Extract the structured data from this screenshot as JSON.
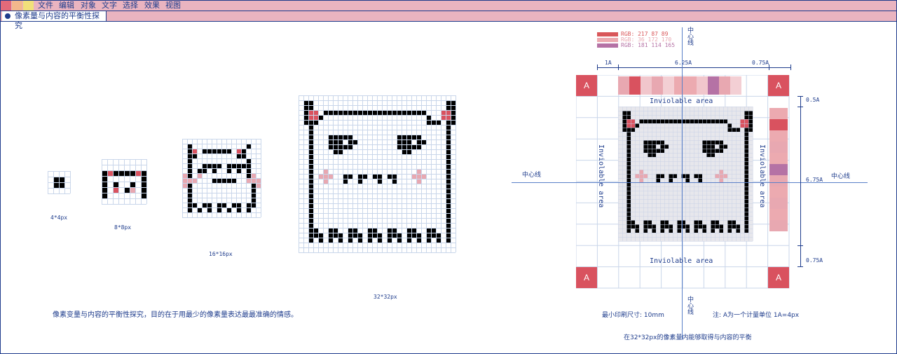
{
  "colors": {
    "menubar_bg": "#eab4c0",
    "ink": "#1e3c8c",
    "grid": "#c9d6ea",
    "black": "#000000",
    "red": "#d9525f",
    "pink": "#e8a8b1",
    "purple": "#b7729d",
    "sprite_fill": "#ffffff",
    "safe_fill": "#e7e7ec",
    "window_buttons": [
      "#e36a7a",
      "#f3b78c",
      "#f1e07a"
    ]
  },
  "menu": {
    "items": [
      "文件",
      "编辑",
      "对象",
      "文字",
      "选择",
      "效果",
      "视图"
    ]
  },
  "tab": {
    "title": "像素量与内容的平衡性探究"
  },
  "labels": {
    "s4": "4*4px",
    "s8": "8*8px",
    "s16": "16*16px",
    "s32": "32*32px"
  },
  "description": "像素变量与内容的平衡性探究，目的在于用最少的像素量表达最最准确的情感。",
  "diagram": {
    "swatches": [
      {
        "label": "RGB: 217 87 89",
        "color": "#d9575a"
      },
      {
        "label": "RGB: 36 172 170",
        "color": "#ecaab0"
      },
      {
        "label": "RGB: 181 114 165",
        "color": "#b572a5"
      }
    ],
    "top_measure": [
      "1A",
      "6.25A",
      "0.75A"
    ],
    "right_measure": [
      "0.5A",
      "6.75A",
      "0.75A"
    ],
    "center_line": "中心线",
    "inviolable": "Inviolable area",
    "corner_letter": "A",
    "min_print": "最小印刷尺寸: 10mm",
    "unit_note": "注: A为一个计量单位 1A=4px",
    "caption": "在32*32px的像素量内能够取得与内容的平衡"
  },
  "sprites": {
    "ghost32": {
      "pattern": [
        "................................",
        ".##...........................##",
        ".##...........................##",
        ".#rr.#####################...rr#",
        ".#rr#.....................#..rr#",
        ".###......................###.##",
        "..#...........................#.",
        "..#...........................#.",
        "..#...#####.........#####.....#.",
        "..#...###.##........###.##....#.",
        "..#...#####.........#####.....#.",
        "..#....##............##.......#.",
        "..#...........................#.",
        "..#...........................#.",
        "..#...........................#.",
        "..#..p..................p.....#.",
        "..#.ppp..##.##.##.##...ppp....#.",
        "..#..p...#..#...#..#....p.....#.",
        "..#...........................#.",
        "..#...........................#.",
        "..#...........................#.",
        "..#...........................#.",
        "..#...........................#.",
        "..#...........................#.",
        "..#...........................#.",
        "..#...........................#.",
        "..#...........................#.",
        "..##..##..##..##..##..##..##..#.",
        "..###.###.###.###.###.###.###.#.",
        "..#.#.#.#.#.#.#.#.#.#.#.#.#.#.#.",
        "................................",
        "................................"
      ],
      "pixel": 7,
      "grid": true
    },
    "cat16": {
      "pattern": [
        "................",
        ".#...........#..",
        ".#r.######.r#...",
        ".##........##...",
        ".#...........#..",
        ".#..####.#####..",
        ".#.##.#..#.#.#..",
        "p#.p.........#p.",
        "ppp...#####..ppp",
        "p#............#p",
        ".#............#.",
        ".#............#.",
        ".#............#.",
        ".##.##.##.##.##.",
        ".#.#.#.#.#.#.#..",
        "................"
      ],
      "pixel": 7,
      "grid": true
    },
    "cat8": {
      "pattern": [
        "........",
        "........",
        "#r####r#",
        "#......#",
        "#.#..#.#",
        "#.r.#p.#",
        "#......#",
        "........"
      ],
      "pixel": 8,
      "grid": true
    },
    "dot4": {
      "pattern": [
        "....",
        ".##.",
        ".##.",
        "...."
      ],
      "pixel": 8,
      "grid": true
    }
  }
}
